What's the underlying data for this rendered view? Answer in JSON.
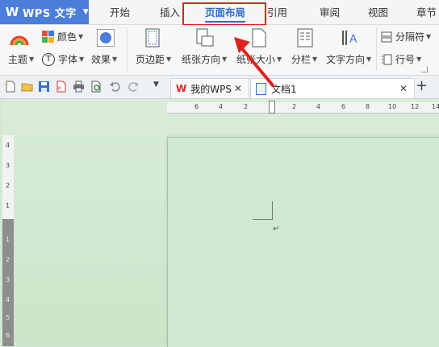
{
  "app": {
    "logo": "W",
    "title": "WPS 文字"
  },
  "menu": {
    "tabs": [
      {
        "label": "开始"
      },
      {
        "label": "插入"
      },
      {
        "label": "页面布局"
      },
      {
        "label": "引用"
      },
      {
        "label": "审阅"
      },
      {
        "label": "视图"
      },
      {
        "label": "章节"
      }
    ],
    "active_tab": "页面布局"
  },
  "ribbon": {
    "theme": "主题",
    "color": "颜色",
    "font": "字体",
    "effect": "效果",
    "margin": "页边距",
    "orientation": "纸张方向",
    "size": "纸张大小",
    "columns": "分栏",
    "text_direction": "文字方向",
    "separator": "分隔符",
    "line_number": "行号"
  },
  "tabs": {
    "home": "我的WPS",
    "document": "文档1"
  },
  "ruler": {
    "horizontal": [
      "6",
      "4",
      "2",
      "2",
      "4",
      "6",
      "8",
      "10",
      "12",
      "14"
    ],
    "vertical": [
      "4",
      "3",
      "2",
      "1",
      "1",
      "2",
      "3",
      "4",
      "5",
      "6"
    ]
  },
  "document": {
    "paragraph_mark": "↵"
  },
  "colors": {
    "app_button": "#4a7ed9",
    "active_tab": "#2d6ccc",
    "highlight": "#e0211d",
    "workspace": "#cfe6cf"
  }
}
